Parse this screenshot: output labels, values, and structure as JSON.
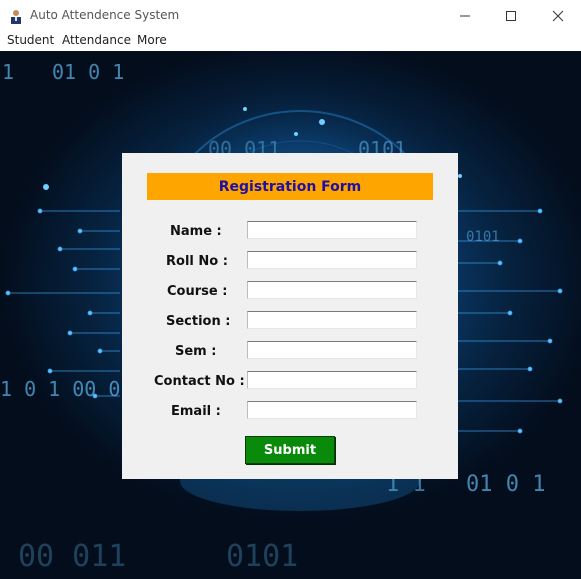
{
  "window": {
    "title": "Auto Attendence System",
    "controls": {
      "minimize": "—",
      "maximize": "☐",
      "close": "✕"
    }
  },
  "menu": {
    "items": [
      "Student",
      "Attendance",
      "More"
    ]
  },
  "background": {
    "binary_texts": [
      "1",
      "01 0 1",
      "00 011",
      "0101",
      "1 0 1 00 0",
      "1 1",
      "01 0 1",
      "00 011",
      "0101",
      "0101"
    ]
  },
  "form": {
    "title": "Registration Form",
    "fields": [
      {
        "label": "Name :",
        "value": ""
      },
      {
        "label": "Roll No :",
        "value": ""
      },
      {
        "label": "Course :",
        "value": ""
      },
      {
        "label": "Section :",
        "value": ""
      },
      {
        "label": "Sem :",
        "value": ""
      },
      {
        "label": "Contact No :",
        "value": ""
      },
      {
        "label": "Email :",
        "value": ""
      }
    ],
    "submit_label": "Submit"
  },
  "colors": {
    "header_bg": "#ffa500",
    "header_text": "#1e10a6",
    "submit_bg": "#0a8a0a",
    "panel_bg": "#f0f0f0"
  }
}
